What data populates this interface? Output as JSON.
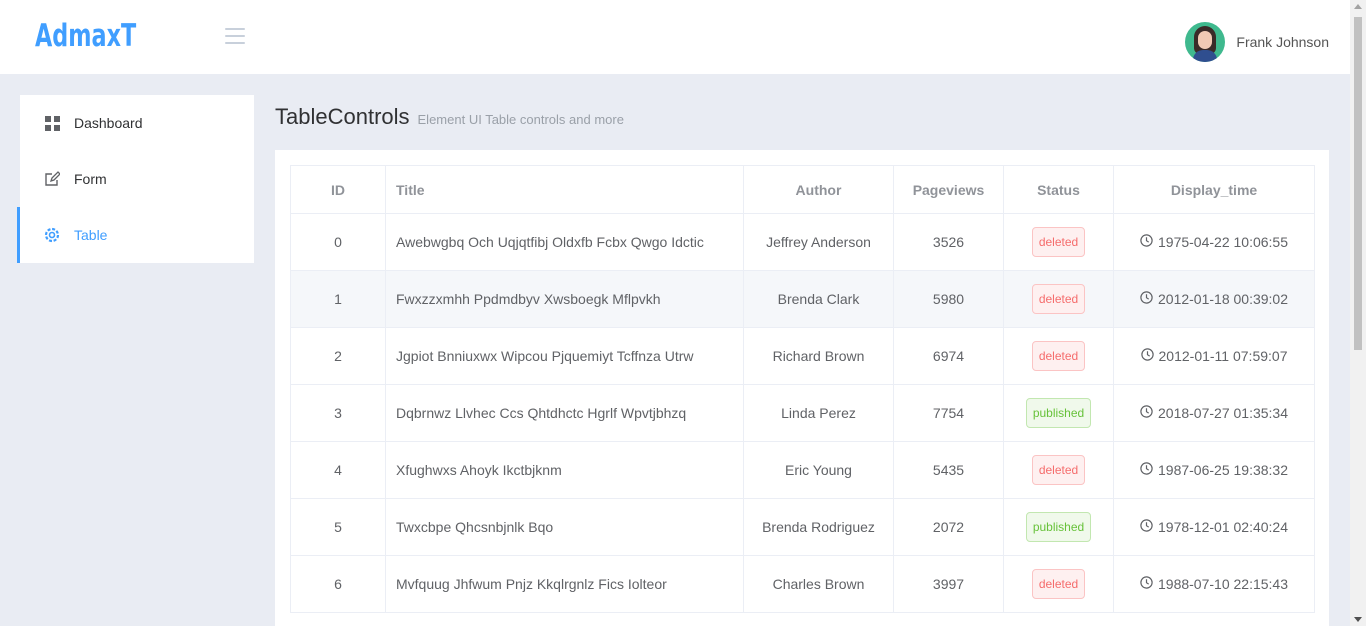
{
  "header": {
    "logo": "AdmaxT",
    "user_name": "Frank Johnson"
  },
  "sidebar": {
    "items": [
      {
        "label": "Dashboard",
        "icon": "grid-icon"
      },
      {
        "label": "Form",
        "icon": "edit-icon"
      },
      {
        "label": "Table",
        "icon": "gear-icon",
        "active": true
      }
    ]
  },
  "page": {
    "title": "TableControls",
    "subtitle": "Element UI Table controls and more"
  },
  "table": {
    "columns": [
      "ID",
      "Title",
      "Author",
      "Pageviews",
      "Status",
      "Display_time"
    ],
    "rows": [
      {
        "id": "0",
        "title": "Awebwgbq Och Uqjqtfibj Oldxfb Fcbx Qwgo Idctic",
        "author": "Jeffrey Anderson",
        "pageviews": "3526",
        "status": "deleted",
        "time": "1975-04-22 10:06:55"
      },
      {
        "id": "1",
        "title": "Fwxzzxmhh Ppdmdbyv Xwsboegk Mflpvkh",
        "author": "Brenda Clark",
        "pageviews": "5980",
        "status": "deleted",
        "time": "2012-01-18 00:39:02"
      },
      {
        "id": "2",
        "title": "Jgpiot Bnniuxwx Wipcou Pjquemiyt Tcffnza Utrw",
        "author": "Richard Brown",
        "pageviews": "6974",
        "status": "deleted",
        "time": "2012-01-11 07:59:07"
      },
      {
        "id": "3",
        "title": "Dqbrnwz Llvhec Ccs Qhtdhctc Hgrlf Wpvtjbhzq",
        "author": "Linda Perez",
        "pageviews": "7754",
        "status": "published",
        "time": "2018-07-27 01:35:34"
      },
      {
        "id": "4",
        "title": "Xfughwxs Ahoyk Ikctbjknm",
        "author": "Eric Young",
        "pageviews": "5435",
        "status": "deleted",
        "time": "1987-06-25 19:38:32"
      },
      {
        "id": "5",
        "title": "Twxcbpe Qhcsnbjnlk Bqo",
        "author": "Brenda Rodriguez",
        "pageviews": "2072",
        "status": "published",
        "time": "1978-12-01 02:40:24"
      },
      {
        "id": "6",
        "title": "Mvfquug Jhfwum Pnjz Kkqlrgnlz Fics Iolteor",
        "author": "Charles Brown",
        "pageviews": "3997",
        "status": "deleted",
        "time": "1988-07-10 22:15:43"
      }
    ]
  },
  "colors": {
    "accent": "#409eff",
    "deleted": "#f56c6c",
    "published": "#67c23a"
  }
}
